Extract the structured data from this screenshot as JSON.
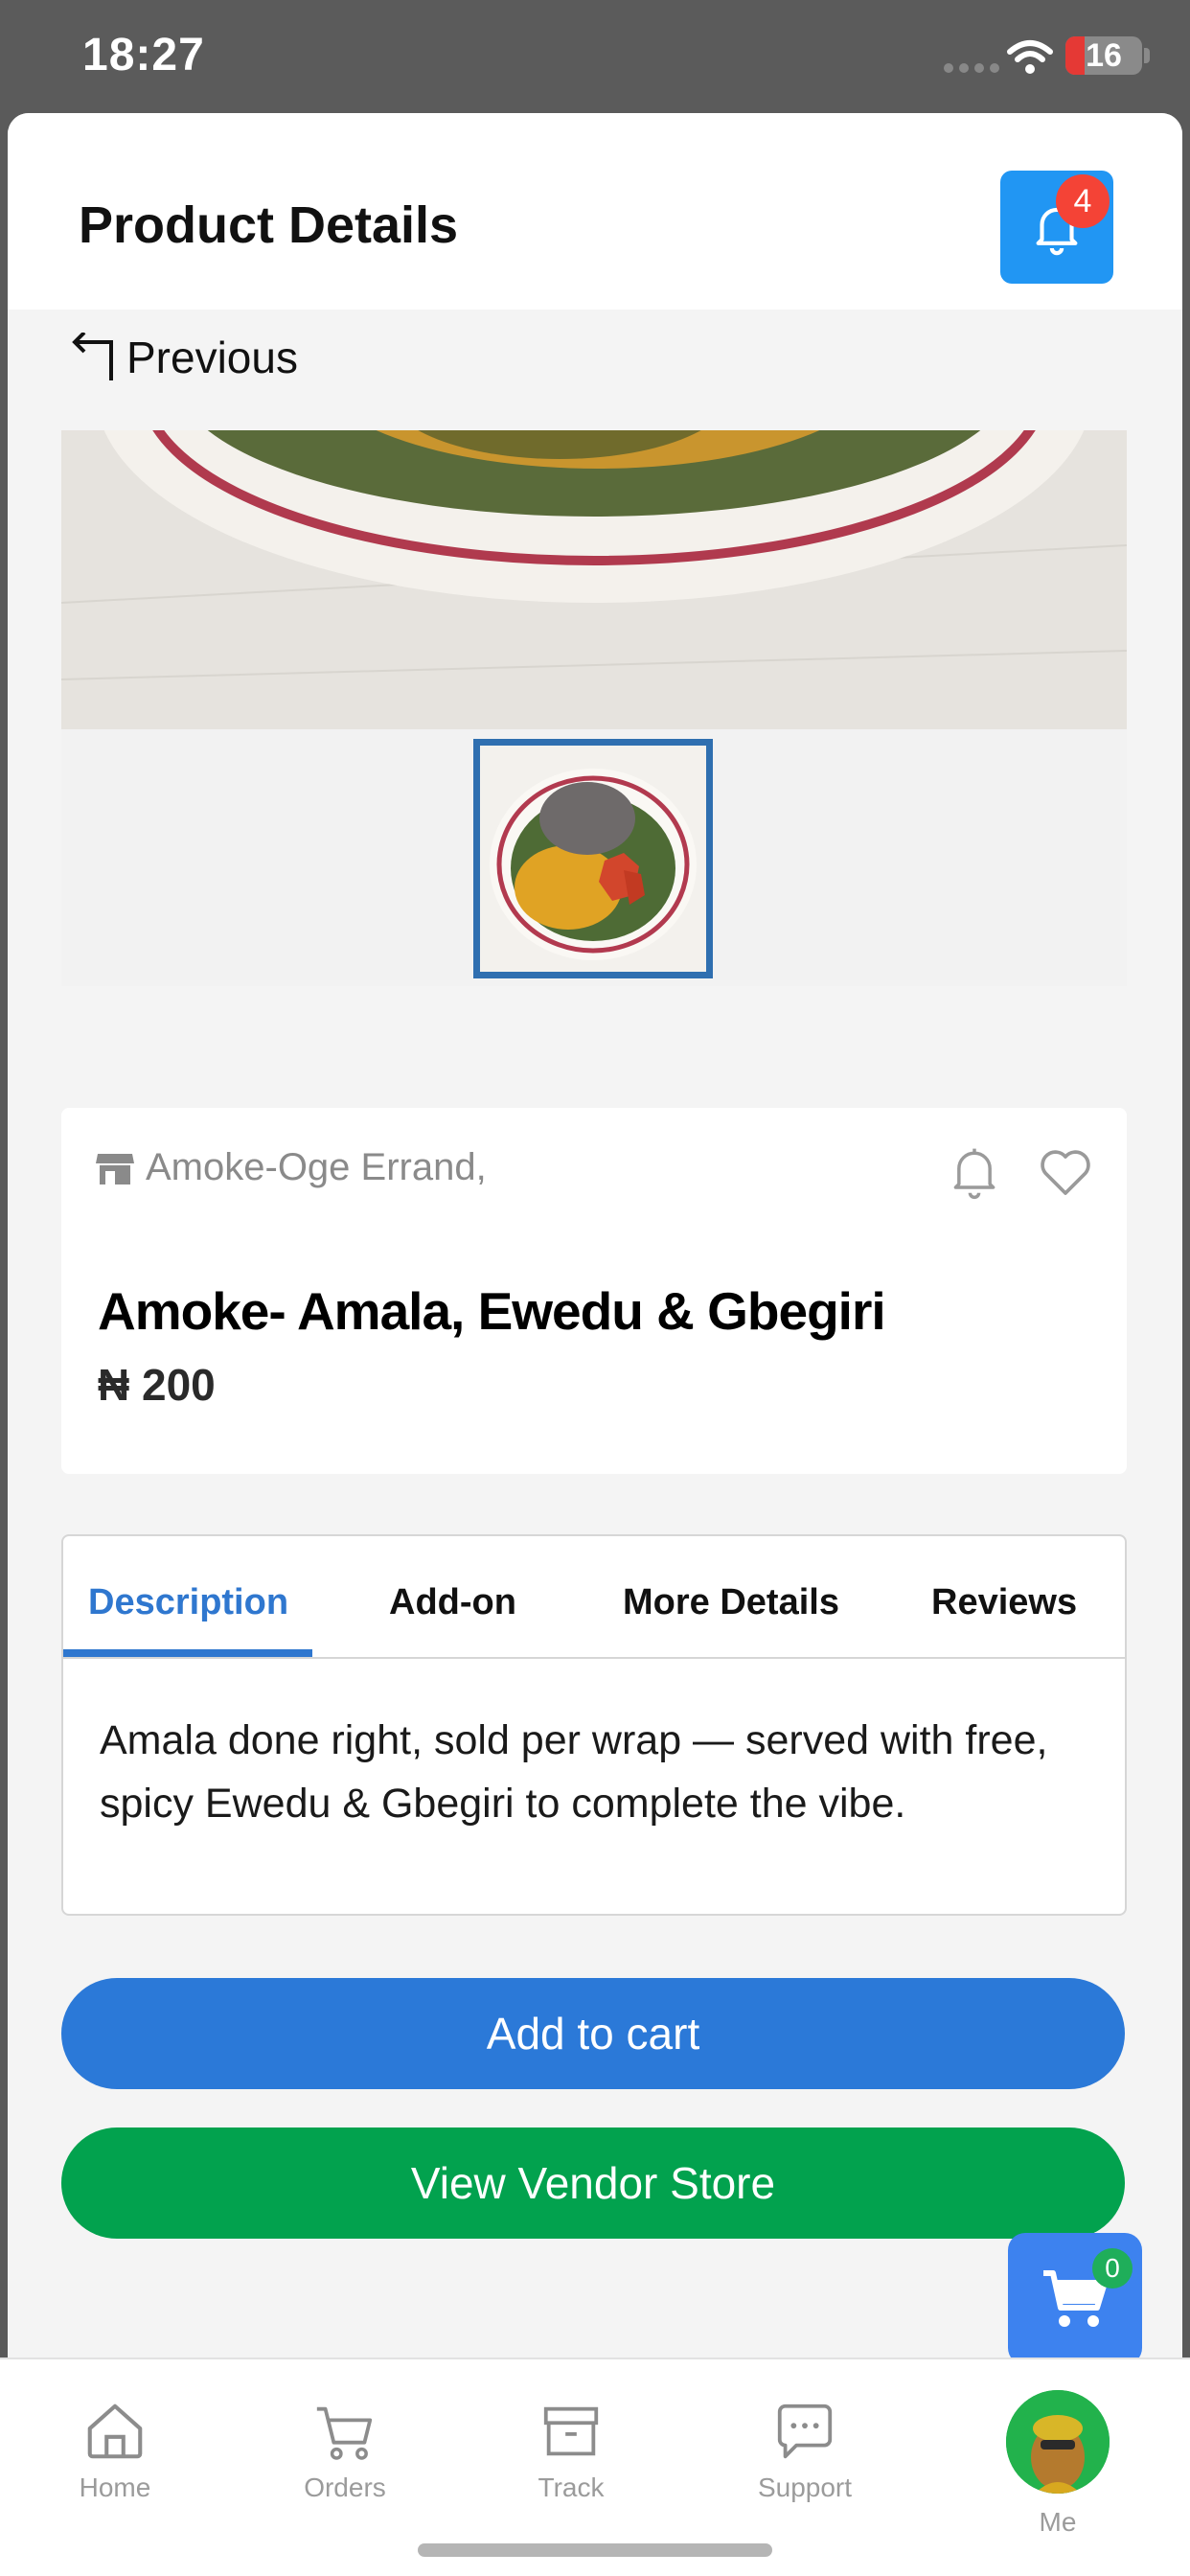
{
  "status_bar": {
    "time": "18:27",
    "battery": "16",
    "battery_level": 0.16
  },
  "header": {
    "title": "Product Details",
    "notification_count": "4"
  },
  "nav": {
    "previous_label": "Previous"
  },
  "product": {
    "store": "Amoke-Oge Errand,",
    "name": "Amoke- Amala, Ewedu & Gbegiri",
    "price": "₦ 200"
  },
  "tabs": {
    "items": [
      {
        "label": "Description",
        "active": true
      },
      {
        "label": "Add-on",
        "active": false
      },
      {
        "label": "More Details",
        "active": false
      },
      {
        "label": "Reviews",
        "active": false
      }
    ],
    "description": "Amala done right, sold per wrap — served with free, spicy Ewedu & Gbegiri to complete the vibe."
  },
  "actions": {
    "add_to_cart": "Add to cart",
    "view_vendor": "View Vendor Store"
  },
  "cart": {
    "count": "0"
  },
  "bottom_nav": {
    "items": [
      {
        "label": "Home",
        "icon": "home-icon"
      },
      {
        "label": "Orders",
        "icon": "cart-icon"
      },
      {
        "label": "Track",
        "icon": "archive-icon"
      },
      {
        "label": "Support",
        "icon": "chat-icon"
      },
      {
        "label": "Me",
        "icon": "avatar"
      }
    ]
  },
  "colors": {
    "accent_blue": "#2196f3",
    "button_blue": "#2b79d8",
    "button_green": "#02a24e",
    "active_tab": "#2f77cf",
    "badge_red": "#f44336",
    "badge_green": "#1fae5a"
  }
}
